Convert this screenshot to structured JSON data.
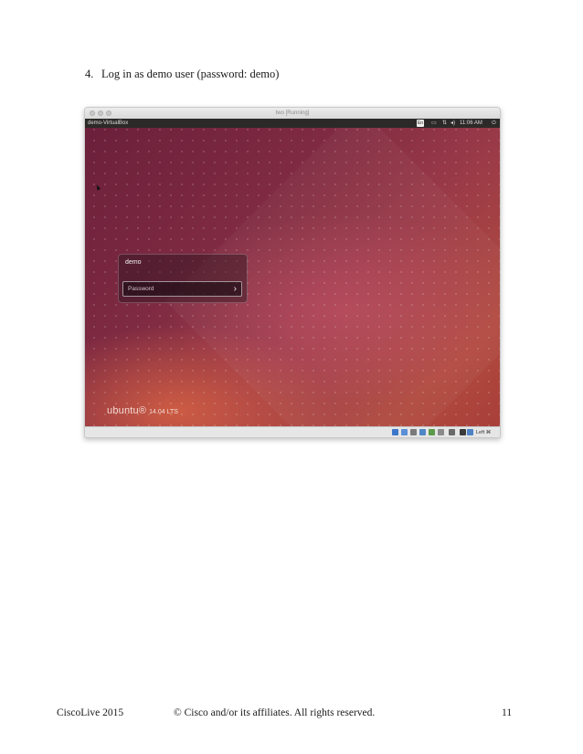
{
  "instruction": {
    "number": "4.",
    "text": "Log in as demo user (password: demo)"
  },
  "vm_window": {
    "title": "two [Running]",
    "panel": {
      "hostname": "demo-VirtualBox",
      "keyboard_badge": "En",
      "clock": "11:06 AM"
    },
    "login": {
      "username": "demo",
      "password_placeholder": "Password",
      "submit_glyph": "›"
    },
    "branding": {
      "wordmark": "ubuntu®",
      "version": "14.04 LTS"
    },
    "status_bar": {
      "host_key": "Left ⌘"
    },
    "colors": {
      "wallpaper_top": "#6b1f3a",
      "wallpaper_bottom": "#b14a3f",
      "panel": "#2c2a28"
    }
  },
  "footer": {
    "left": "CiscoLive 2015",
    "center": "© Cisco and/or its affiliates. All rights reserved.",
    "page_number": "11"
  }
}
